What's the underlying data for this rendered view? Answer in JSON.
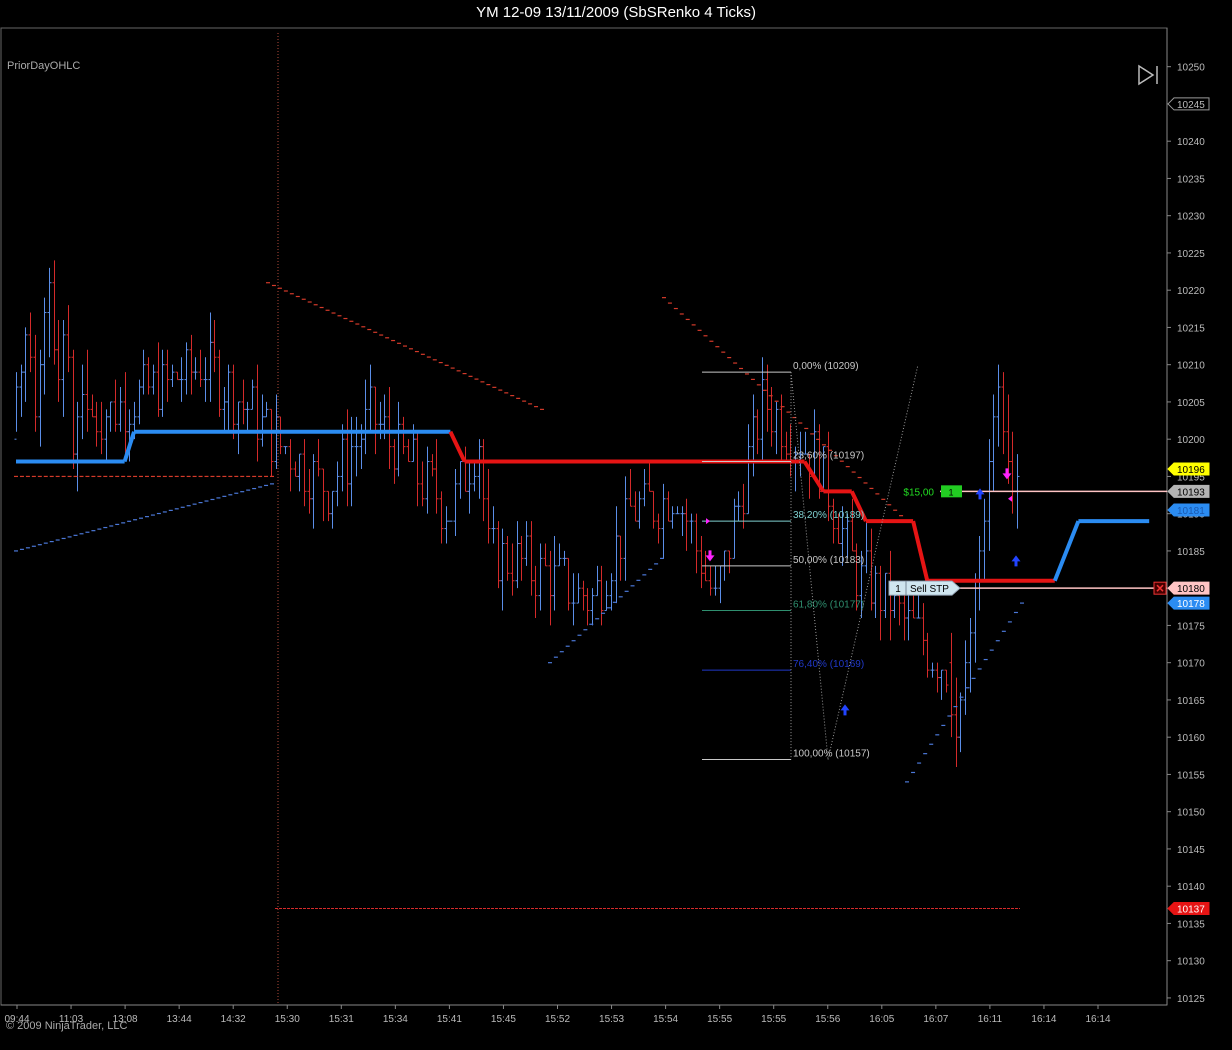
{
  "window": {
    "title": "YM 12-09  13/11/2009 (SbSRenko 4 Ticks)"
  },
  "indicator_label": "PriorDayOHLC",
  "copyright": "© 2009 NinjaTrader, LLC",
  "colors": {
    "background": "#000000",
    "up_bar": "#5b8ee8",
    "down_bar": "#d42a2a",
    "trend_line_up": "#2b8cf2",
    "trend_line_down": "#e61414",
    "stop_dots_down": "#d43a2a",
    "stop_dots_up": "#4b78d8",
    "fib_line": "#c8c8c8",
    "order_line": "#ffc4c4",
    "position_line": "#ffc4c4",
    "axis_text": "#bbbbbb"
  },
  "chart_data": {
    "type": "candlestick-renko",
    "title": "YM 12-09  13/11/2009 (SbSRenko 4 Ticks)",
    "x_tick_labels": [
      "09:44",
      "11:03",
      "13:08",
      "13:44",
      "14:32",
      "15:30",
      "15:31",
      "15:34",
      "15:41",
      "15:45",
      "15:52",
      "15:53",
      "15:54",
      "15:55",
      "15:55",
      "15:56",
      "16:05",
      "16:07",
      "16:11",
      "16:14",
      "16:14"
    ],
    "y_ticks": [
      10125,
      10130,
      10135,
      10140,
      10145,
      10150,
      10155,
      10160,
      10165,
      10170,
      10175,
      10180,
      10185,
      10190,
      10195,
      10200,
      10205,
      10210,
      10215,
      10220,
      10225,
      10230,
      10235,
      10240,
      10245,
      10250
    ],
    "ylim": [
      10123,
      10253
    ],
    "bar_count": 213,
    "bars_start": [
      [
        10200,
        10209,
        10201,
        10207
      ],
      [
        10207,
        10210,
        10203,
        10209
      ],
      [
        10209,
        10215,
        10205,
        10214
      ],
      [
        10214,
        10217,
        10209,
        10211
      ],
      [
        10211,
        10214,
        10201,
        10203
      ],
      [
        10203,
        10212,
        10199,
        10210
      ],
      [
        10210,
        10219,
        10206,
        10217
      ],
      [
        10217,
        10223,
        10211,
        10221
      ],
      [
        10221,
        10224,
        10210,
        10212
      ],
      [
        10212,
        10216,
        10205,
        10208
      ],
      [
        10208,
        10216,
        10203,
        10214
      ],
      [
        10214,
        10218,
        10209,
        10211
      ],
      [
        10211,
        10212,
        10196,
        10198
      ],
      [
        10198,
        10205,
        10193,
        10203
      ],
      [
        10203,
        10210,
        10200,
        10206
      ],
      [
        10206,
        10212,
        10201,
        10204
      ]
    ],
    "bars_end": [
      [
        10170,
        10174,
        10160,
        10163
      ],
      [
        10163,
        10168,
        10156,
        10160
      ],
      [
        10160,
        10166,
        10158,
        10165
      ],
      [
        10165,
        10173,
        10163,
        10170
      ],
      [
        10170,
        10176,
        10166,
        10174
      ],
      [
        10174,
        10182,
        10170,
        10180
      ],
      [
        10180,
        10187,
        10177,
        10185
      ],
      [
        10185,
        10192,
        10181,
        10189
      ],
      [
        10189,
        10200,
        10185,
        10197
      ],
      [
        10197,
        10206,
        10193,
        10203
      ],
      [
        10203,
        10210,
        10199,
        10207
      ],
      [
        10207,
        10209,
        10198,
        10201
      ],
      [
        10201,
        10206,
        10194,
        10197
      ],
      [
        10197,
        10201,
        10190,
        10193
      ],
      [
        10193,
        10198,
        10188,
        10195
      ]
    ],
    "trend_line": [
      {
        "x_from": 0,
        "x_to": 23,
        "y": 10197,
        "state": "up"
      },
      {
        "x_from": 25,
        "x_to": 92,
        "y": 10201,
        "state": "up"
      },
      {
        "x_from": 95,
        "x_to": 167,
        "y": 10197,
        "state": "down"
      },
      {
        "x_from": 171,
        "x_to": 177,
        "y": 10193,
        "state": "down"
      },
      {
        "x_from": 180,
        "x_to": 190,
        "y": 10189,
        "state": "down"
      },
      {
        "x_from": 193,
        "x_to": 220,
        "y": 10181,
        "state": "down"
      },
      {
        "x_from": 225,
        "x_to": 240,
        "y": 10189,
        "state": "up"
      }
    ],
    "fibonacci": {
      "high": 10209,
      "low": 10157,
      "levels": [
        {
          "label": "0,00% (10209)",
          "value": 10209,
          "color": "#c8c8c8"
        },
        {
          "label": "23,60% (10197)",
          "value": 10197,
          "color": "#c8c8c8"
        },
        {
          "label": "38,20% (10189)",
          "value": 10189,
          "color": "#7fd0d0"
        },
        {
          "label": "50,00% (10183)",
          "value": 10183,
          "color": "#c8c8c8"
        },
        {
          "label": "61,80% (10177)",
          "value": 10177,
          "color": "#2f8f6f"
        },
        {
          "label": "76,40% (10169)",
          "value": 10169,
          "color": "#2038c8"
        },
        {
          "label": "100,00% (10157)",
          "value": 10157,
          "color": "#c8c8c8"
        }
      ]
    },
    "prior_day_line": {
      "value": 10137,
      "color": "#d42a2a"
    },
    "price_markers": [
      {
        "label": "10245",
        "value": 10245,
        "bg": "#000000",
        "fg": "#bbbbbb",
        "border": "#999999"
      },
      {
        "label": "10196",
        "value": 10196,
        "bg": "#ffff00",
        "fg": "#000000",
        "border": "#ffff00"
      },
      {
        "label": "10193",
        "value": 10193,
        "bg": "#b4b4b4",
        "fg": "#000000",
        "border": "#b4b4b4"
      },
      {
        "label": "10181",
        "value": 10190.5,
        "bg": "#2b8cf2",
        "fg": "#1b5ab0",
        "border": "#2b8cf2"
      },
      {
        "label": "10180",
        "value": 10180,
        "bg": "#ffc4c4",
        "fg": "#000000",
        "border": "#ffc4c4"
      },
      {
        "label": "10178",
        "value": 10178,
        "bg": "#2b8cf2",
        "fg": "#ffffff",
        "border": "#2b8cf2"
      },
      {
        "label": "10137",
        "value": 10137,
        "bg": "#e61414",
        "fg": "#ffffff",
        "border": "#e61414"
      }
    ],
    "orders": {
      "position": {
        "pnl_label": "$15,00",
        "qty_label": "1",
        "price": 10193
      },
      "stop": {
        "qty_label": "1",
        "label": "Sell STP",
        "price": 10180
      }
    }
  }
}
